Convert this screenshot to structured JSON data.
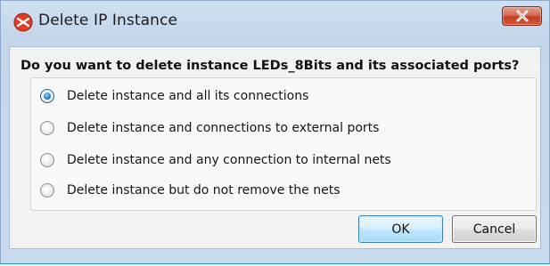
{
  "window": {
    "title": "Delete IP Instance",
    "icon": "xilinx-logo-icon",
    "close_icon": "close-icon"
  },
  "dialog": {
    "question": "Do you want to delete instance LEDs_8Bits and its associated ports?",
    "options": [
      {
        "label": "Delete instance and all its connections",
        "checked": true
      },
      {
        "label": "Delete instance and connections to external ports",
        "checked": false
      },
      {
        "label": "Delete instance and any connection to internal nets",
        "checked": false
      },
      {
        "label": "Delete instance but do not remove the nets",
        "checked": false
      }
    ],
    "ok_label": "OK",
    "cancel_label": "Cancel"
  },
  "colors": {
    "close_button": "#c9452b",
    "accent": "#3c7fb1"
  }
}
